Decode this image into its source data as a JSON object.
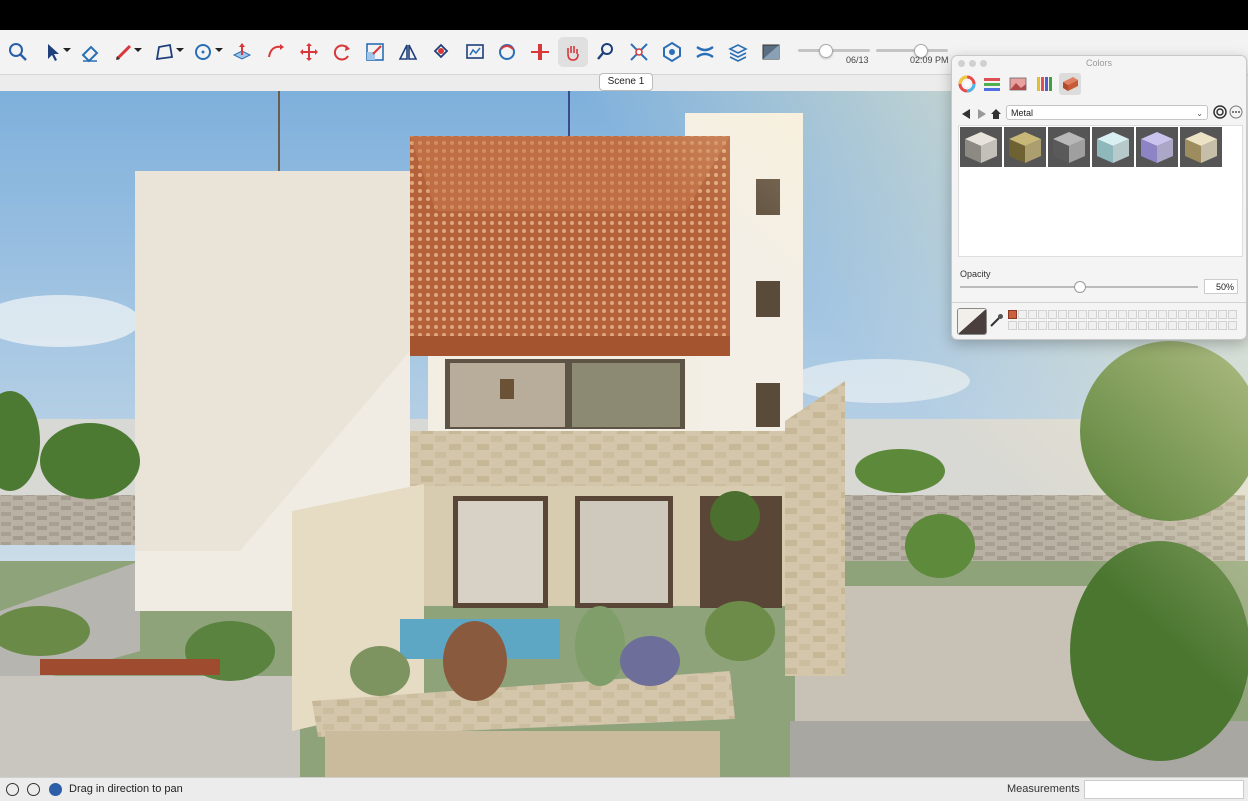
{
  "toolbar": {
    "tools": [
      {
        "id": "search-icon",
        "color": "#2a5ea8"
      },
      {
        "id": "select-icon",
        "color": "#1e3f7a"
      },
      {
        "id": "eraser-icon",
        "color": "#2a6fb5"
      },
      {
        "id": "pencil-icon",
        "color": "#d8383a"
      },
      {
        "id": "polygon-icon",
        "color": "#1e3f7a"
      },
      {
        "id": "circle-icon",
        "color": "#2a6fb5"
      },
      {
        "id": "push-pull-icon",
        "color": "#d8383a"
      },
      {
        "id": "follow-me-icon",
        "color": "#d8383a"
      },
      {
        "id": "move-icon",
        "color": "#d8383a"
      },
      {
        "id": "rotate-icon",
        "color": "#d8383a"
      },
      {
        "id": "scale-icon",
        "color": "#d8383a"
      },
      {
        "id": "flip-icon",
        "color": "#1e3f7a"
      },
      {
        "id": "paint-bucket-icon",
        "color": "#d8383a"
      },
      {
        "id": "text-label-icon",
        "color": "#1e3f7a"
      },
      {
        "id": "orbit-icon",
        "color": "#2a6fb5"
      },
      {
        "id": "section-plane-icon",
        "color": "#d8383a"
      },
      {
        "id": "pan-icon",
        "color": "#d8383a"
      },
      {
        "id": "zoom-icon",
        "color": "#1e3f7a"
      },
      {
        "id": "zoom-extents-icon",
        "color": "#2a6fb5"
      },
      {
        "id": "components-icon",
        "color": "#2a6fb5"
      },
      {
        "id": "shadows-icon",
        "color": "#2a6fb5"
      },
      {
        "id": "layers-icon",
        "color": "#2a6fb5"
      },
      {
        "id": "materials-icon",
        "color": "#2a6fb5"
      }
    ],
    "shadow_date": "06/13",
    "shadow_time": "02:09 PM"
  },
  "scene_tab": "Scene 1",
  "colors_panel": {
    "title": "Colors",
    "library": "Metal",
    "opacity_label": "Opacity",
    "opacity_value": "50%",
    "opacity_fraction": 0.5,
    "swatches": [
      {
        "name": "silver-metal-swatch",
        "light": "#e8e4dc",
        "dark": "#8d8a83"
      },
      {
        "name": "brass-metal-swatch",
        "light": "#c8b878",
        "dark": "#6f6232"
      },
      {
        "name": "steel-metal-swatch",
        "light": "#b8b8b8",
        "dark": "#5a5a5a"
      },
      {
        "name": "aqua-metal-swatch",
        "light": "#d8f0f2",
        "dark": "#8fb8bd"
      },
      {
        "name": "lavender-metal-swatch",
        "light": "#c9c3ee",
        "dark": "#8c84c4"
      },
      {
        "name": "gold-metal-swatch",
        "light": "#ece2c4",
        "dark": "#9c8c5e"
      }
    ],
    "recent_color": "#c9603e"
  },
  "status": {
    "text": "Drag in direction to pan",
    "measurements_label": "Measurements",
    "measurements_value": ""
  },
  "scene_colors": {
    "sky_top": "#7eb0dc",
    "sky_bottom": "#e8eef2",
    "facade": "#f2ece2",
    "screen": "#b9653a",
    "stone": "#cfc2a6",
    "foliage": "#5a8a3a"
  }
}
